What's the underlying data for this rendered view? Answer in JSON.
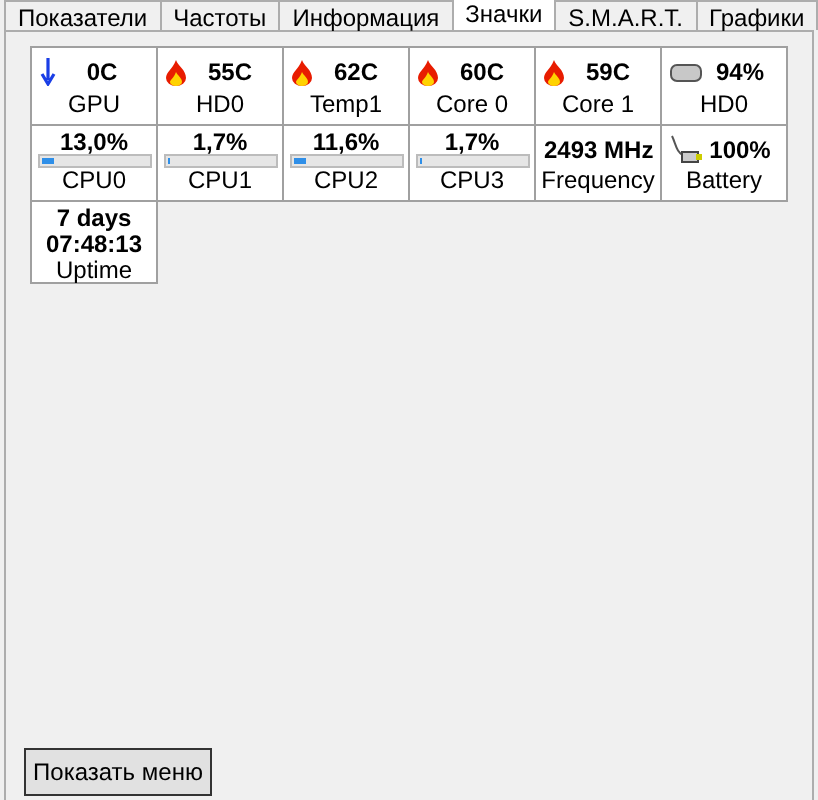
{
  "tabs": [
    {
      "label": "Показатели",
      "selected": false
    },
    {
      "label": "Частоты",
      "selected": false
    },
    {
      "label": "Информация",
      "selected": false
    },
    {
      "label": "Значки",
      "selected": true
    },
    {
      "label": "S.M.A.R.T.",
      "selected": false
    },
    {
      "label": "Графики",
      "selected": false
    }
  ],
  "tiles": [
    {
      "kind": "sensor",
      "value": "0C",
      "label": "GPU"
    },
    {
      "kind": "sensor",
      "value": "55C",
      "label": "HD0"
    },
    {
      "kind": "sensor",
      "value": "62C",
      "label": "Temp1"
    },
    {
      "kind": "sensor",
      "value": "60C",
      "label": "Core 0"
    },
    {
      "kind": "sensor",
      "value": "59C",
      "label": "Core 1"
    },
    {
      "kind": "sensor",
      "value": "94%",
      "label": "HD0"
    },
    {
      "kind": "meter",
      "value": "13,0%",
      "level": 0.13,
      "label": "CPU0"
    },
    {
      "kind": "meter",
      "value": "1,7%",
      "level": 0.017,
      "label": "CPU1"
    },
    {
      "kind": "meter",
      "value": "11,6%",
      "level": 0.116,
      "label": "CPU2"
    },
    {
      "kind": "meter",
      "value": "1,7%",
      "level": 0.017,
      "label": "CPU3"
    },
    {
      "kind": "plain",
      "value": "2493 MHz",
      "label": "Frequency"
    },
    {
      "kind": "sensor",
      "value": "100%",
      "label": "Battery"
    },
    {
      "kind": "uptime",
      "value": "7 days 07:48:13",
      "label": "Uptime"
    }
  ],
  "menu_button": "Показать меню"
}
